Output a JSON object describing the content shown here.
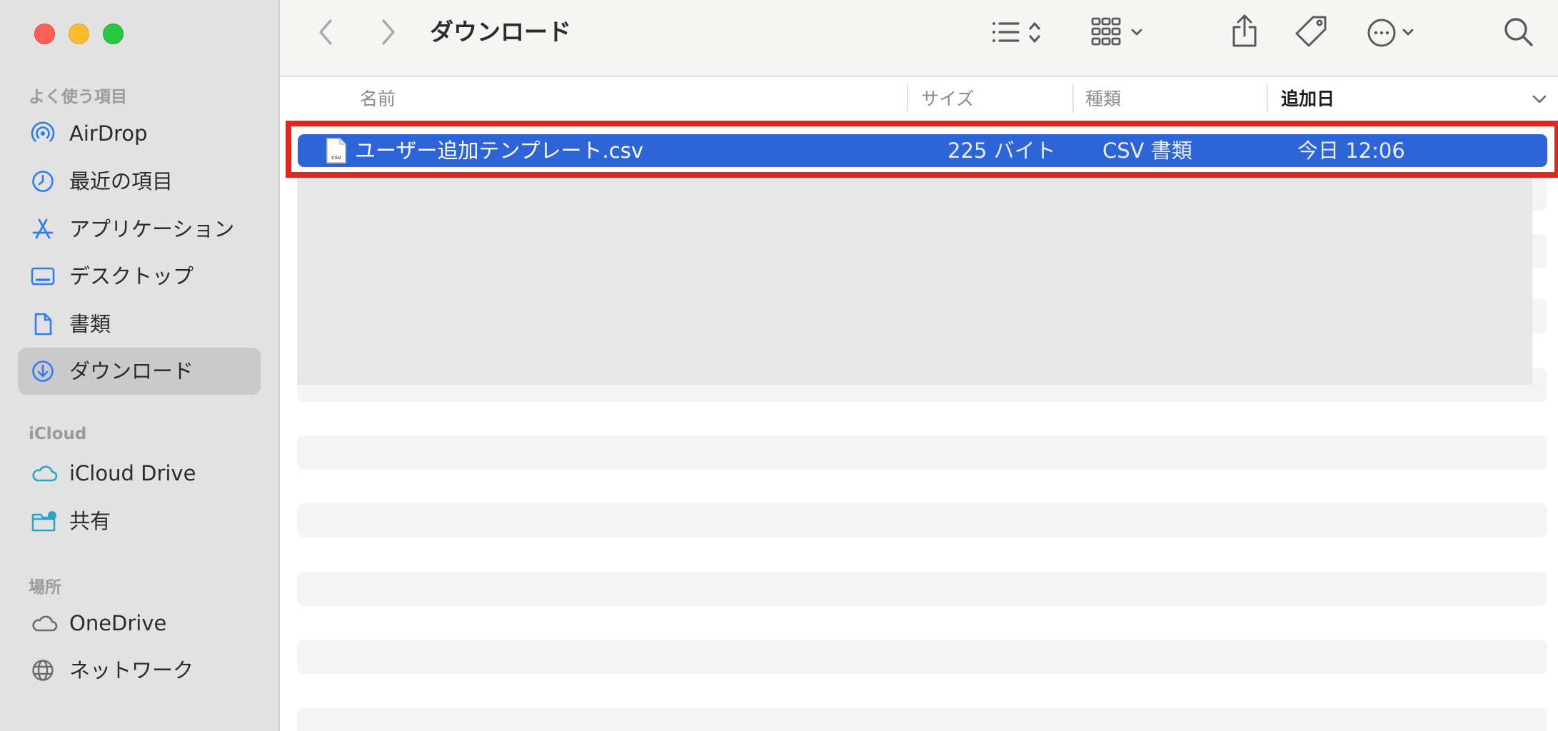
{
  "sidebar": {
    "favorites_title": "よく使う項目",
    "icloud_title": "iCloud",
    "locations_title": "場所",
    "favorites": [
      {
        "label": "AirDrop",
        "icon": "airdrop-icon"
      },
      {
        "label": "最近の項目",
        "icon": "clock-icon"
      },
      {
        "label": "アプリケーション",
        "icon": "applications-icon"
      },
      {
        "label": "デスクトップ",
        "icon": "desktop-icon"
      },
      {
        "label": "書類",
        "icon": "document-icon"
      },
      {
        "label": "ダウンロード",
        "icon": "download-icon",
        "selected": true
      }
    ],
    "icloud": [
      {
        "label": "iCloud Drive",
        "icon": "cloud-icon"
      },
      {
        "label": "共有",
        "icon": "shared-folder-icon"
      }
    ],
    "locations": [
      {
        "label": "OneDrive",
        "icon": "cloud-icon"
      },
      {
        "label": "ネットワーク",
        "icon": "globe-icon"
      }
    ]
  },
  "toolbar": {
    "title": "ダウンロード",
    "icons": [
      "back-icon",
      "forward-icon",
      "list-view-icon",
      "grid-view-icon",
      "share-icon",
      "tag-icon",
      "more-icon",
      "search-icon"
    ]
  },
  "columns": {
    "name": "名前",
    "size": "サイズ",
    "kind": "種類",
    "date_added": "追加日"
  },
  "files": [
    {
      "name": "ユーザー追加テンプレート.csv",
      "size": "225 バイト",
      "kind": "CSV 書類",
      "date_added": "今日 12:06",
      "icon_label": "CSV",
      "selected": true
    }
  ],
  "colors": {
    "selection": "#2d65d8",
    "highlight_box": "#e3261c",
    "sidebar_accent": "#2f7cf6"
  }
}
